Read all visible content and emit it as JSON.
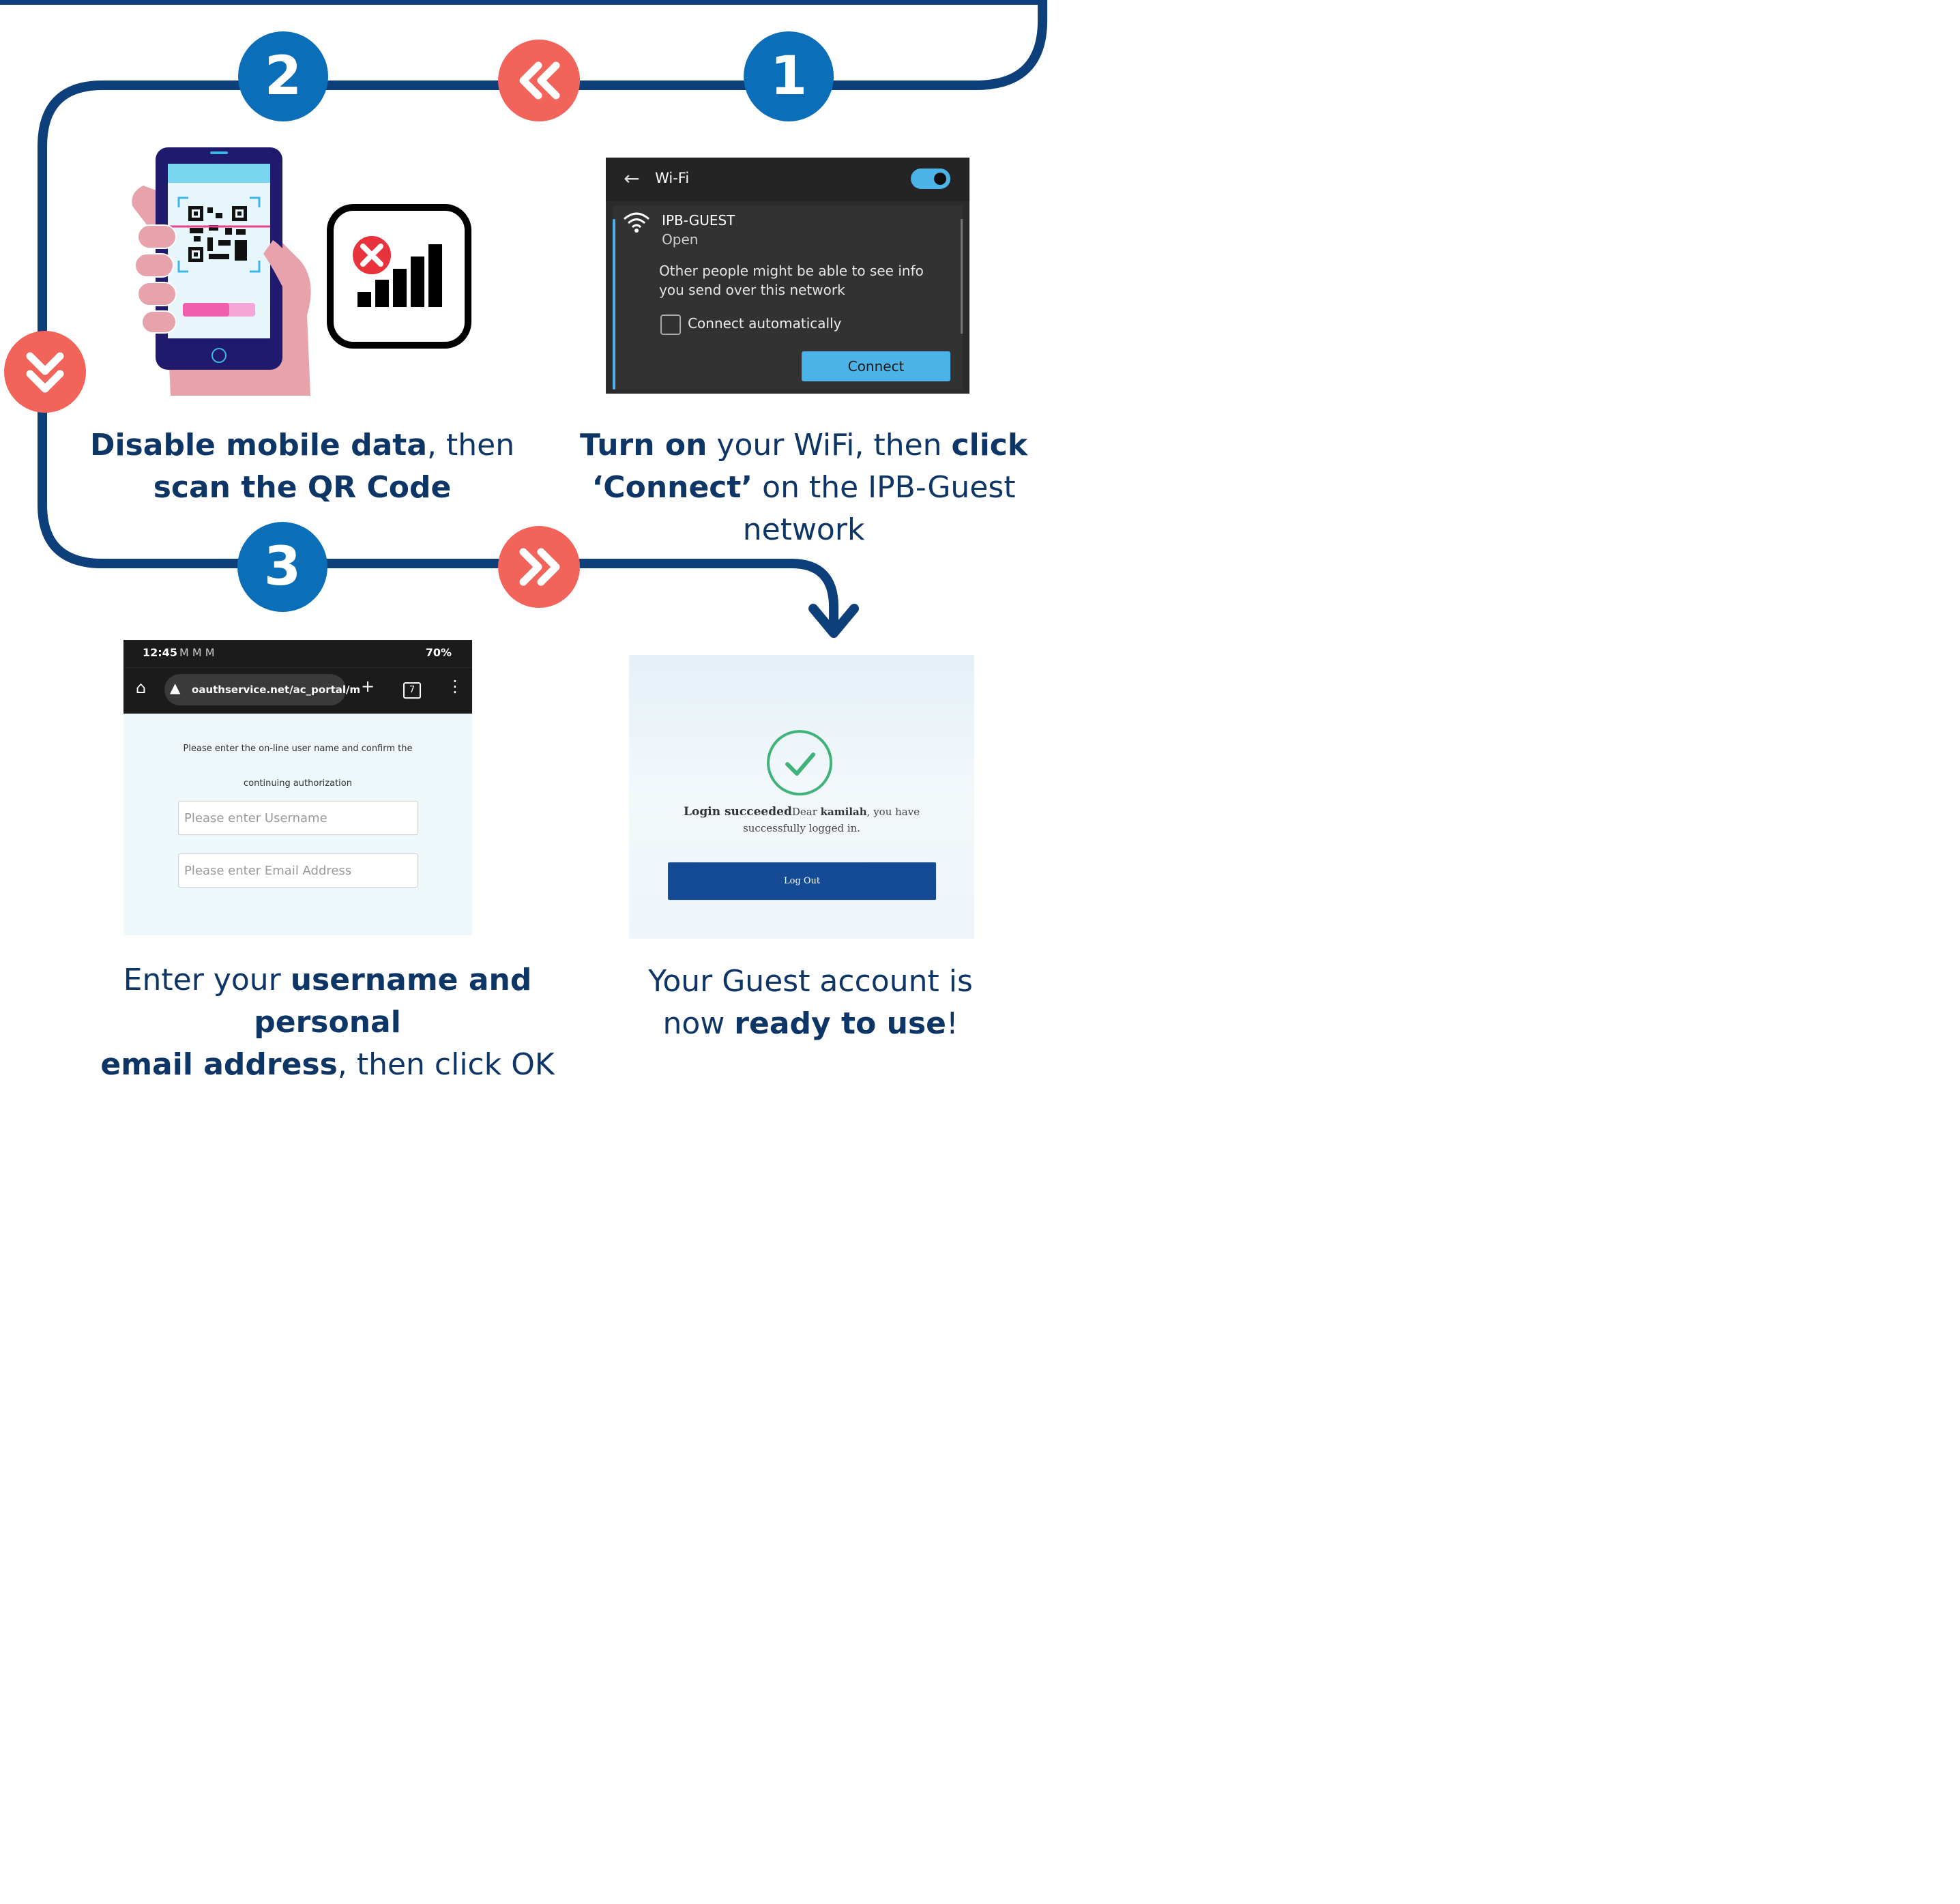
{
  "steps": [
    {
      "number": "1",
      "caption": {
        "b1": "Turn on",
        "t1": " your WiFi, then ",
        "b2": "click",
        "b3": "‘Connect’",
        "t2": " on the IPB-Guest network"
      }
    },
    {
      "number": "2",
      "caption": {
        "b1": "Disable mobile data",
        "t1": ", then",
        "b2": "scan the QR Code"
      }
    },
    {
      "number": "3",
      "caption": {
        "t1": "Enter your ",
        "b1": "username and personal",
        "b2": "email address",
        "t2": ", then click OK"
      }
    },
    {
      "caption": {
        "t1": "Your Guest account is",
        "t2": "now ",
        "b1": "ready to use",
        "t3": "!"
      }
    }
  ],
  "colors": {
    "flow_line": "#0d3f7a",
    "number_badge": "#0a6fb8",
    "arrow_badge": "#f2645a",
    "text": "#0d3566"
  },
  "wifi_panel": {
    "title": "Wi-Fi",
    "back_icon": "←",
    "network_name": "IPB-GUEST",
    "network_status": "Open",
    "warning": "Other people might be able to see info you send over this network",
    "checkbox_label": "Connect automatically",
    "button": "Connect"
  },
  "browser": {
    "time": "12:45",
    "status_icons": "M M M",
    "battery": "70%",
    "url": "oauthservice.net/ac_portal/m",
    "tab_count": "7",
    "instruction_line1": "Please enter the on-line user name and confirm the",
    "instruction_line2": "continuing authorization",
    "username_placeholder": "Please enter Username",
    "email_placeholder": "Please enter Email Address"
  },
  "success": {
    "title": "Login succeeded",
    "message_pre": "Dear ",
    "user": "kamilah",
    "message_post": ", you have",
    "message_line2": "successfully logged in.",
    "button": "Log Out"
  }
}
